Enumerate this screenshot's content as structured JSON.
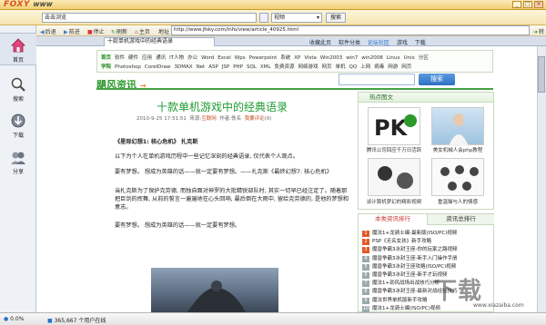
{
  "app": {
    "logo_main": "FOXY",
    "logo_sub": "WWW",
    "win_min": "_",
    "win_max": "□",
    "win_close": "×"
  },
  "searchbar": {
    "query_value": "击击浏览",
    "engine_value": "视频",
    "search_button": "搜索"
  },
  "toolbar": {
    "back": "后退",
    "forward": "前进",
    "stop": "停止",
    "refresh": "刷新",
    "home": "主页",
    "address_label": "地址",
    "address_value": "http://www.jfsky.com/info/view/article_40925.html",
    "go_label": "转到",
    "right_links": [
      "收藏此页",
      "软件分类",
      "论坛社区",
      "游戏",
      "下载"
    ]
  },
  "tabs": [
    {
      "label": "十款单机游戏中的经典语录"
    }
  ],
  "leftnav": [
    {
      "label": "首页",
      "icon": "home-icon"
    },
    {
      "label": "搜索",
      "icon": "search-icon"
    },
    {
      "label": "下载",
      "icon": "download-icon"
    },
    {
      "label": "分享",
      "icon": "share-icon"
    }
  ],
  "sitenav": {
    "row1": [
      "首页",
      "软件",
      "硬件",
      "应用",
      "通讯",
      "IT人物",
      "办公",
      "Word",
      "Excel",
      "Wps",
      "Powerpoint",
      "系统",
      "XP",
      "Vista",
      "Win2003",
      "win7",
      "win2008",
      "Linux",
      "Unix",
      "分区"
    ],
    "row2": [
      "学院",
      "Photoshop",
      "CorelDraw",
      "3DMAX",
      "Net",
      "ASP",
      "JSP",
      "PHP",
      "SQL",
      "XML",
      "免费资源",
      "网络游戏",
      "网页",
      "单机",
      "QQ",
      "上网",
      "病毒",
      "网游",
      "网页"
    ]
  },
  "site": {
    "logo_a": "飓风资讯",
    "logo_b": "→",
    "search_button": "搜索"
  },
  "article": {
    "title": "十款单机游戏中的经典语录",
    "date": "2010-9-25 17:51:51",
    "source_label": "来源:",
    "source": "互联网",
    "author_label": "作者:",
    "author": "佚名",
    "comments_label": "我要评论",
    "comments_count": "(0)",
    "paragraphs": [
      "《星际幻想1: 核心危机》 扎克斯",
      "以下为个人在单机游戏历程中一些记忆深刻的经典语录, 仅代表个人观点。",
      "要有梦想。 想成为英雄的话——就一定要有梦想。——扎克斯《最终幻想7: 核心危机》",
      "当扎克斯为了保护克劳德, 而独自面对神罗的大批精锐部队时, 其实一切早已经注定了。随着那把巨剑的挥舞, 从前的誓言一遍遍地在心头回响, 最后倒在大雨中, 留给克劳德的, 是他的梦想和意志。",
      "要有梦想。 想成为英雄的话——就一定要有梦想。"
    ]
  },
  "rightcol": {
    "hot_title": "热点图文",
    "hot_items": [
      {
        "caption": "腾讯公司回应千万日活跃"
      },
      {
        "caption": "美女机械人会php教程"
      },
      {
        "caption": "谈计算机梦幻的精彩视频"
      },
      {
        "caption": "重温猫与人的情感"
      }
    ],
    "rank_tabs": [
      "本类资讯排行",
      "资讯总排行"
    ],
    "rank_items": [
      "魔法1+龙骑士编-最新版(ISO/PC)视频",
      "PSP《无名女孩》新手攻略",
      "魔兽争霸3冰封王座-你的玩家之路视频",
      "魔兽争霸3冰封王座-新手入门操作手册",
      "魔兽争霸3冰封王座攻略(ISO/PC)视频",
      "魔兽争霸3冰封王座-新手才玩视频",
      "魔法1+劲风战场出战技巧分析",
      "魔兽争霸3冰封王座-最新对战经验技巧",
      "魔法世界单机版新手攻略",
      "魔法1+龙骑士编(ISO/PC)视频"
    ]
  },
  "statusbar": {
    "zoom": "0.0%",
    "users": "365,667 个用户在线"
  },
  "watermark": {
    "brand": "下载",
    "url": "www.xiazaiba.com"
  },
  "colors": {
    "accent_green": "#1f9a31",
    "title_bar": "#f3cf74",
    "brand_orange": "#ff7d00"
  }
}
